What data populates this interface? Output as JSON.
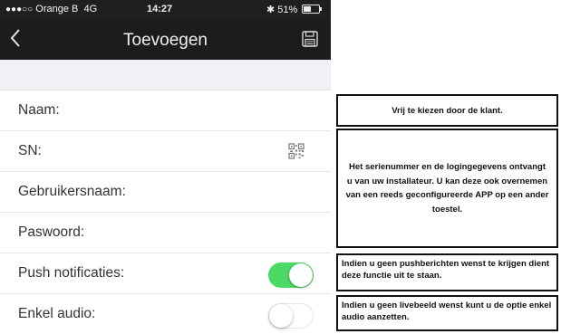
{
  "status_bar": {
    "signal": "●●●○○",
    "carrier": "Orange B",
    "network": "4G",
    "time": "14:27",
    "bluetooth": "✱",
    "battery_text": "51%",
    "battery_level": 0.51
  },
  "nav": {
    "back_icon": "chevron-left",
    "title": "Toevoegen",
    "save_icon": "floppy-disk"
  },
  "form": {
    "name_label": "Naam:",
    "sn_label": "SN:",
    "user_label": "Gebruikersnaam:",
    "password_label": "Paswoord:",
    "push_label": "Push notificaties:",
    "push_on": true,
    "audio_label": "Enkel audio:",
    "audio_on": false
  },
  "notes": {
    "name_note": "Vrij te kiezen door de klant.",
    "sn_note": "Het serienummer en de logingegevens ontvangt u van uw installateur. U kan deze ook overnemen van een reeds geconfigureerde APP op een ander toestel.",
    "push_note": "Indien u geen pushberichten wenst te krijgen dient deze functie uit te staan.",
    "audio_note": "Indien u geen livebeeld wenst kunt u de optie enkel audio aanzetten."
  },
  "colors": {
    "switch_on": "#4cd964",
    "navbar": "#1c1c1c"
  }
}
